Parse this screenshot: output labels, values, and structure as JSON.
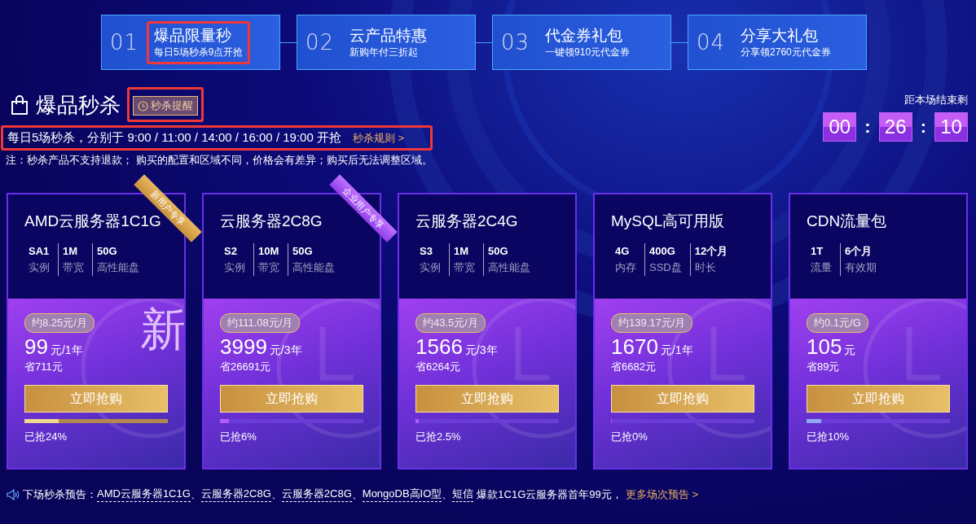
{
  "steps": [
    {
      "number": "01",
      "title": "爆品限量秒",
      "subtitle": "每日5场秒杀9点开抢",
      "highlighted": true
    },
    {
      "number": "02",
      "title": "云产品特惠",
      "subtitle": "新购年付三折起",
      "highlighted": false
    },
    {
      "number": "03",
      "title": "代金券礼包",
      "subtitle": "一键领910元代金券",
      "highlighted": false
    },
    {
      "number": "04",
      "title": "分享大礼包",
      "subtitle": "分享领2760元代金券",
      "highlighted": false
    }
  ],
  "section": {
    "title": "爆品秒杀",
    "remind_button": {
      "label": "秒杀提醒",
      "highlighted": true
    },
    "schedule": {
      "text": "每日5场秒杀，分别于 9:00 / 11:00 / 14:00 / 16:00 / 19:00 开抢",
      "link": "秒杀规则 >",
      "highlighted": true
    },
    "note": "注：秒杀产品不支持退款； 购买的配置和区域不同，价格会有差异；购买后无法调整区域。"
  },
  "countdown": {
    "label": "距本场结束剩",
    "parts": [
      "00",
      "26",
      "10"
    ],
    "separator": ":"
  },
  "cards": [
    {
      "title": "AMD云服务器1C1G",
      "ribbon": {
        "text": "新用户专享",
        "kind": "gold"
      },
      "specs": [
        {
          "value": "SA1",
          "label": "实例"
        },
        {
          "value": "1M",
          "label": "带宽"
        },
        {
          "value": "50G",
          "label": "高性能盘"
        }
      ],
      "emblem": {
        "kind": "text",
        "text": "新"
      },
      "unit_price": "约8.25元/月",
      "price": "99",
      "price_unit": "元/1年",
      "saving": "省711元",
      "button": "立即抢购",
      "progress": {
        "kind": "gold",
        "level": 0.24,
        "color": "#f0d890"
      },
      "sold": "已抢24%"
    },
    {
      "title": "云服务器2C8G",
      "ribbon": {
        "text": "企业用户专享",
        "kind": "purple"
      },
      "specs": [
        {
          "value": "S2",
          "label": "实例"
        },
        {
          "value": "10M",
          "label": "带宽"
        },
        {
          "value": "50G",
          "label": "高性能盘"
        }
      ],
      "emblem": {
        "kind": "clock"
      },
      "unit_price": "约111.08元/月",
      "price": "3999",
      "price_unit": "元/3年",
      "saving": "省26691元",
      "button": "立即抢购",
      "progress": {
        "kind": "purple",
        "level": 0.06,
        "color": "#b05cf5"
      },
      "sold": "已抢6%"
    },
    {
      "title": "云服务器2C4G",
      "specs": [
        {
          "value": "S3",
          "label": "实例"
        },
        {
          "value": "1M",
          "label": "带宽"
        },
        {
          "value": "50G",
          "label": "高性能盘"
        }
      ],
      "emblem": {
        "kind": "clock"
      },
      "unit_price": "约43.5元/月",
      "price": "1566",
      "price_unit": "元/3年",
      "saving": "省6264元",
      "button": "立即抢购",
      "progress": {
        "kind": "purple",
        "level": 0.025,
        "color": "#b05cf5"
      },
      "sold": "已抢2.5%"
    },
    {
      "title": "MySQL高可用版",
      "specs": [
        {
          "value": "4G",
          "label": "内存"
        },
        {
          "value": "400G",
          "label": "SSD盘"
        },
        {
          "value": "12个月",
          "label": "时长"
        }
      ],
      "emblem": {
        "kind": "clock"
      },
      "unit_price": "约139.17元/月",
      "price": "1670",
      "price_unit": "元/1年",
      "saving": "省6682元",
      "button": "立即抢购",
      "progress": {
        "kind": "purple",
        "level": 0,
        "color": "#b05cf5"
      },
      "sold": "已抢0%"
    },
    {
      "title": "CDN流量包",
      "specs": [
        {
          "value": "1T",
          "label": "流量"
        },
        {
          "value": "6个月",
          "label": "有效期"
        }
      ],
      "emblem": {
        "kind": "clock"
      },
      "unit_price": "约0.1元/G",
      "price": "105",
      "price_unit": "元",
      "saving": "省89元",
      "button": "立即抢购",
      "progress": {
        "kind": "purple",
        "level": 0.1,
        "color": "#8fa8f0"
      },
      "sold": "已抢10%"
    }
  ],
  "ticker": {
    "label": "下场秒杀预告：",
    "items": [
      {
        "text": "AMD云服务器1C1G",
        "kind": "link",
        "sep": "、"
      },
      {
        "text": "云服务器2C8G",
        "kind": "link",
        "sep": "、"
      },
      {
        "text": "云服务器2C8G",
        "kind": "link",
        "sep": "、"
      },
      {
        "text": "MongoDB高IO型",
        "kind": "link",
        "sep": "、"
      },
      {
        "text": "短信",
        "kind": "link"
      },
      {
        "text": "爆款1C1G云服务器首年99元，",
        "kind": "plain"
      }
    ],
    "more": "更多场次预告 >"
  }
}
